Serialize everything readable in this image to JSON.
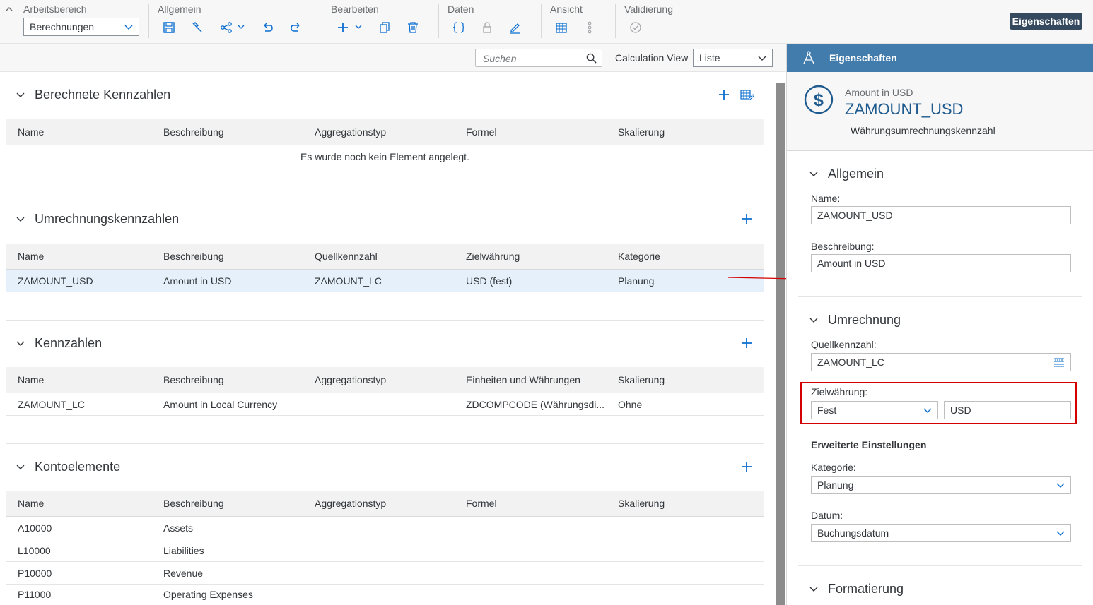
{
  "toolbar": {
    "groups": {
      "arbeitsbereich": "Arbeitsbereich",
      "allgemein": "Allgemein",
      "bearbeiten": "Bearbeiten",
      "daten": "Daten",
      "ansicht": "Ansicht",
      "validierung": "Validierung"
    },
    "workspace_select": "Berechnungen",
    "properties_button": "Eigenschaften"
  },
  "searchbar": {
    "placeholder": "Suchen",
    "view_label": "Calculation View",
    "view_select": "Liste"
  },
  "sections": {
    "calculated": {
      "title": "Berechnete Kennzahlen",
      "columns": [
        "Name",
        "Beschreibung",
        "Aggregationstyp",
        "Formel",
        "Skalierung"
      ],
      "empty_text": "Es wurde noch kein Element angelegt."
    },
    "conversion": {
      "title": "Umrechnungskennzahlen",
      "columns": [
        "Name",
        "Beschreibung",
        "Quellkennzahl",
        "Zielwährung",
        "Kategorie"
      ],
      "rows": [
        [
          "ZAMOUNT_USD",
          "Amount in USD",
          "ZAMOUNT_LC",
          "USD (fest)",
          "Planung"
        ]
      ]
    },
    "measures": {
      "title": "Kennzahlen",
      "columns": [
        "Name",
        "Beschreibung",
        "Aggregationstyp",
        "Einheiten und Währungen",
        "Skalierung"
      ],
      "rows": [
        [
          "ZAMOUNT_LC",
          "Amount in Local Currency",
          "",
          "ZDCOMPCODE (Währungsdi...",
          "Ohne"
        ]
      ]
    },
    "accounts": {
      "title": "Kontoelemente",
      "columns": [
        "Name",
        "Beschreibung",
        "Aggregationstyp",
        "Formel",
        "Skalierung"
      ],
      "rows": [
        [
          "A10000",
          "Assets"
        ],
        [
          "L10000",
          "Liabilities"
        ],
        [
          "P10000",
          "Revenue"
        ],
        [
          "P11000",
          "Operating Expenses"
        ]
      ]
    }
  },
  "panel": {
    "header": "Eigenschaften",
    "object_subtitle": "Amount in USD",
    "object_name": "ZAMOUNT_USD",
    "object_type": "Währungsumrechnungskennzahl",
    "general": {
      "title": "Allgemein",
      "name_label": "Name:",
      "name_value": "ZAMOUNT_USD",
      "desc_label": "Beschreibung:",
      "desc_value": "Amount in USD"
    },
    "conversion": {
      "title": "Umrechnung",
      "source_label": "Quellkennzahl:",
      "source_value": "ZAMOUNT_LC",
      "target_label": "Zielwährung:",
      "target_mode": "Fest",
      "target_currency": "USD",
      "advanced_title": "Erweiterte Einstellungen",
      "category_label": "Kategorie:",
      "category_value": "Planung",
      "date_label": "Datum:",
      "date_value": "Buchungsdatum"
    },
    "formatting": {
      "title": "Formatierung"
    }
  },
  "colors": {
    "accent": "#0a6ed1",
    "panel_header": "#427cac",
    "button_dark": "#354a5f",
    "highlight": "#d40000"
  }
}
